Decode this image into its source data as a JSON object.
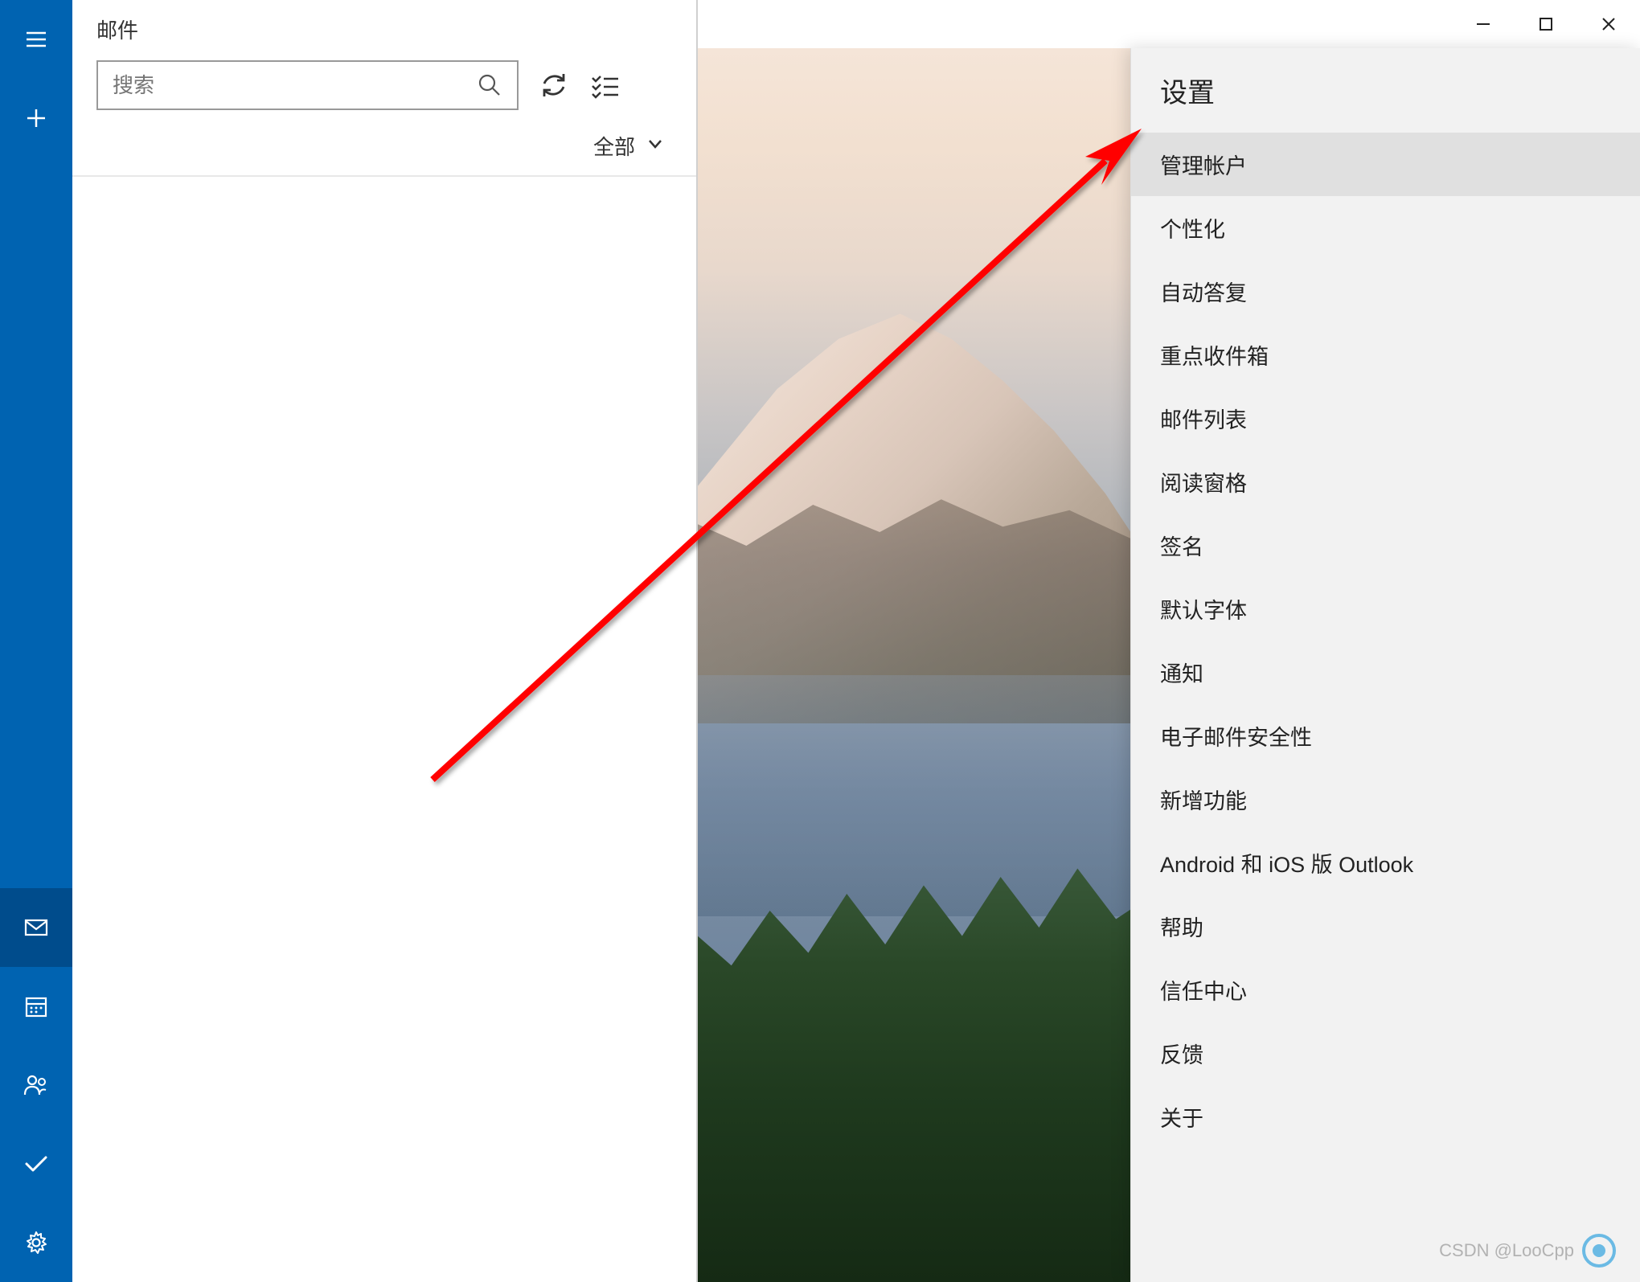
{
  "app": {
    "title": "邮件"
  },
  "search": {
    "placeholder": "搜索"
  },
  "filter": {
    "label": "全部"
  },
  "settings": {
    "title": "设置",
    "items": [
      "管理帐户",
      "个性化",
      "自动答复",
      "重点收件箱",
      "邮件列表",
      "阅读窗格",
      "签名",
      "默认字体",
      "通知",
      "电子邮件安全性",
      "新增功能",
      "Android 和 iOS 版 Outlook",
      "帮助",
      "信任中心",
      "反馈",
      "关于"
    ]
  },
  "watermark": {
    "text": "CSDN @LooCpp"
  }
}
